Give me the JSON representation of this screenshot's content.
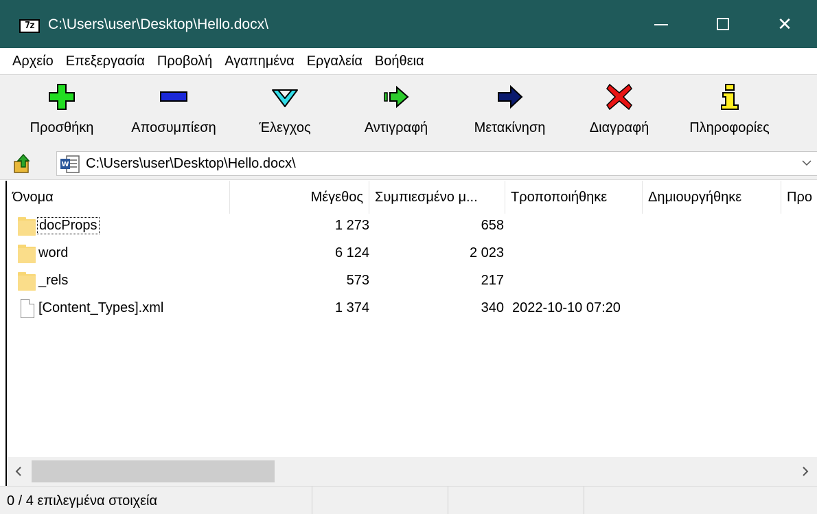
{
  "window": {
    "title": "C:\\Users\\user\\Desktop\\Hello.docx\\",
    "app_icon_text": "7z",
    "close_glyph": "✕"
  },
  "menu": [
    "Αρχείο",
    "Επεξεργασία",
    "Προβολή",
    "Αγαπημένα",
    "Εργαλεία",
    "Βοήθεια"
  ],
  "toolbar": {
    "add": "Προσθήκη",
    "extract": "Αποσυμπίεση",
    "test": "Έλεγχος",
    "copy": "Αντιγραφή",
    "move": "Μετακίνηση",
    "delete": "Διαγραφή",
    "info": "Πληροφορίες"
  },
  "address": {
    "path": "C:\\Users\\user\\Desktop\\Hello.docx\\"
  },
  "columns": {
    "name": "Όνομα",
    "size": "Μέγεθος",
    "packed": "Συμπιεσμένο μ...",
    "modified": "Τροποποιήθηκε",
    "created": "Δημιουργήθηκε",
    "extra": "Προ"
  },
  "rows": [
    {
      "name": "docProps",
      "size": "1 273",
      "packed": "658",
      "modified": "",
      "type": "folder"
    },
    {
      "name": "word",
      "size": "6 124",
      "packed": "2 023",
      "modified": "",
      "type": "folder"
    },
    {
      "name": "_rels",
      "size": "573",
      "packed": "217",
      "modified": "",
      "type": "folder"
    },
    {
      "name": "[Content_Types].xml",
      "size": "1 374",
      "packed": "340",
      "modified": "2022-10-10 07:20",
      "type": "file"
    }
  ],
  "status": {
    "selection": "0 / 4 επιλεγμένα στοιχεία"
  },
  "colors": {
    "titlebar": "#1f5a5a",
    "folder": "#f8d775"
  },
  "icons": {
    "add": "green-plus-icon",
    "extract": "blue-minus-icon",
    "test": "cyan-check-icon",
    "copy": "green-double-arrow-icon",
    "move": "navy-arrow-icon",
    "delete": "red-x-icon",
    "info": "yellow-info-icon"
  }
}
